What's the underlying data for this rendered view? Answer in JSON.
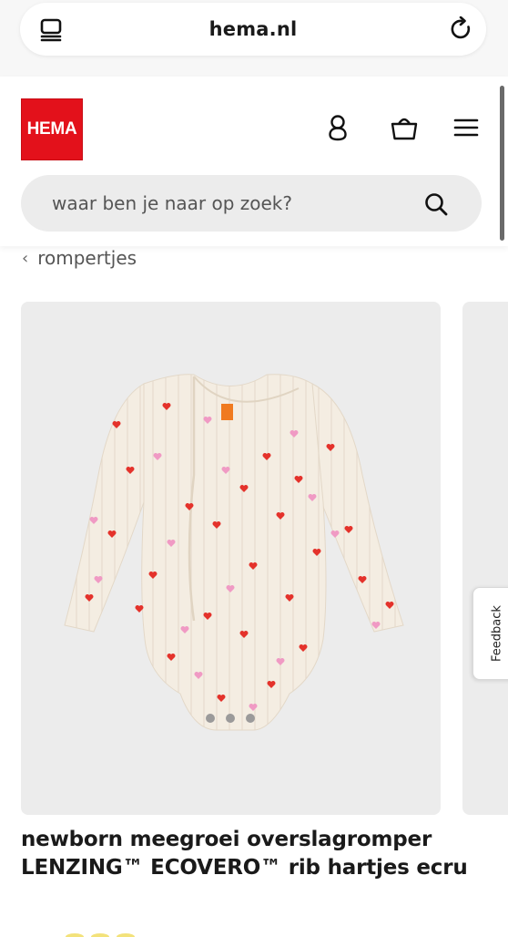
{
  "browser": {
    "url": "hema.nl",
    "icons": {
      "tabs": "tabs-icon",
      "reload": "reload-icon"
    }
  },
  "header": {
    "logo_text": "HEMA",
    "brand_color": "#e3111b",
    "icons": {
      "account": "user-icon",
      "cart": "basket-icon",
      "menu": "hamburger-menu-icon"
    },
    "search": {
      "placeholder": "waar ben je naar op zoek?",
      "value": ""
    }
  },
  "breadcrumb": {
    "label": "rompertjes"
  },
  "product": {
    "image": "newborn-romper-hearts-image",
    "title": "newborn meegroei overslagromper LENZING™ ECOVERO™ rib hartjes ecru"
  },
  "feedback": {
    "label": "Feedback"
  }
}
